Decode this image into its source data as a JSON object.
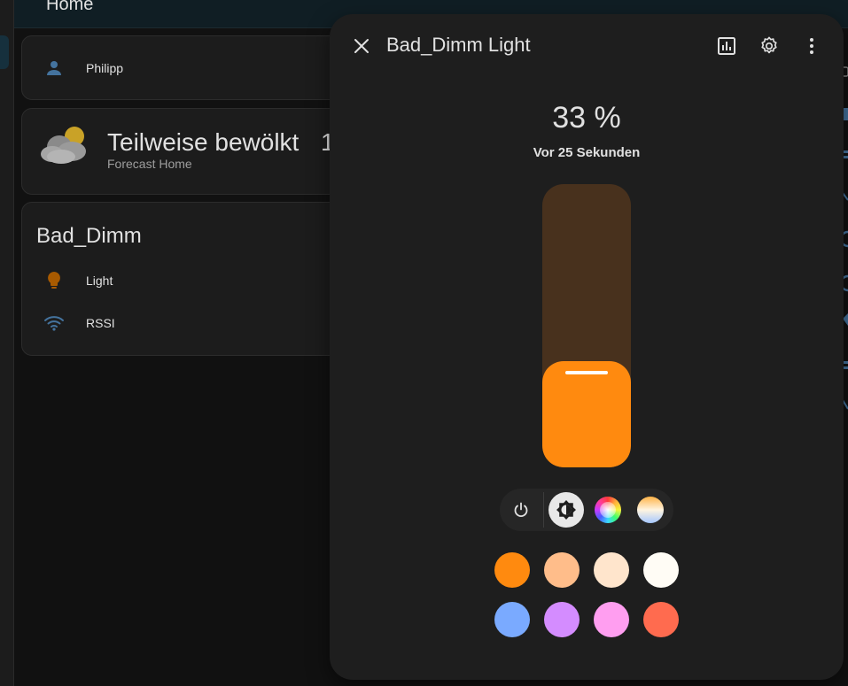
{
  "header": {
    "title": "Home"
  },
  "cards": {
    "person": {
      "name": "Philipp",
      "icon": "account-icon"
    },
    "weather": {
      "condition": "Teilweise bewölkt",
      "temp_partial": "1",
      "subtitle": "Forecast Home",
      "icon": "partly-cloudy-icon"
    },
    "device": {
      "title": "Bad_Dimm",
      "rows": [
        {
          "label": "Light",
          "icon": "lightbulb-icon",
          "color": "#a85a00"
        },
        {
          "label": "RSSI",
          "icon": "wifi-icon",
          "color": "#44739e"
        }
      ]
    }
  },
  "dialog": {
    "title": "Bad_Dimm Light",
    "brightness_text": "33 %",
    "brightness_fraction": 0.33,
    "last_changed": "Vor 25 Sekunden",
    "accent": "#ff8a0f",
    "slider_track": "#48311d",
    "modes": [
      {
        "name": "power",
        "icon": "power-icon"
      },
      {
        "name": "brightness",
        "icon": "brightness-icon",
        "active": true
      },
      {
        "name": "color",
        "icon": "color-wheel-icon"
      },
      {
        "name": "temperature",
        "icon": "color-temp-icon"
      }
    ],
    "favorite_colors": [
      "#ff8a0f",
      "#ffbd8a",
      "#ffe5cc",
      "#fffcf5",
      "#7aaaff",
      "#d48cff",
      "#ff9ef0",
      "#ff6b4f"
    ]
  }
}
